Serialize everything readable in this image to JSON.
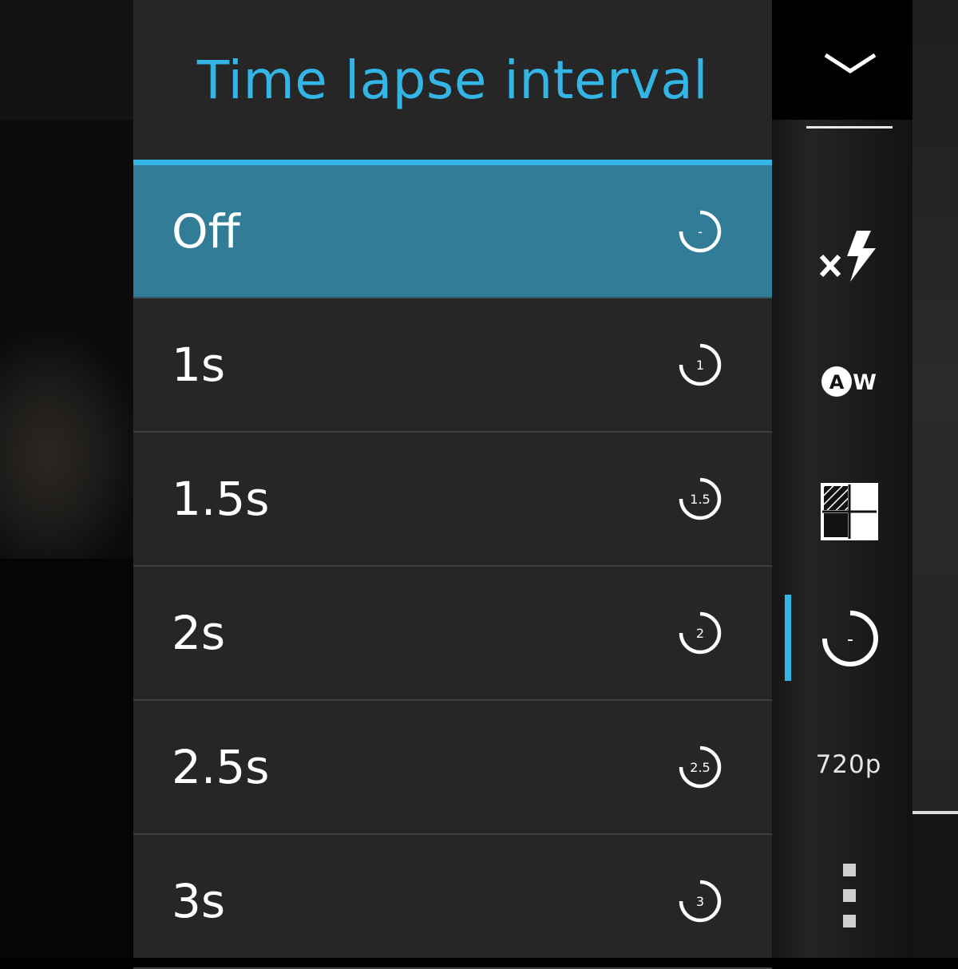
{
  "dialog": {
    "title": "Time lapse interval",
    "accent_color": "#33b5e5",
    "selected_color": "#317d98",
    "options": [
      {
        "label": "Off",
        "icon_text": "-",
        "selected": true
      },
      {
        "label": "1s",
        "icon_text": "1",
        "selected": false
      },
      {
        "label": "1.5s",
        "icon_text": "1.5",
        "selected": false
      },
      {
        "label": "2s",
        "icon_text": "2",
        "selected": false
      },
      {
        "label": "2.5s",
        "icon_text": "2.5",
        "selected": false
      },
      {
        "label": "3s",
        "icon_text": "3",
        "selected": false
      }
    ]
  },
  "sidebar": {
    "collapse_icon": "chevron-down-icon",
    "flash_icon": "flash-off-icon",
    "white_balance_icon": "white-balance-auto-icon",
    "white_balance_text": "W",
    "white_balance_badge": "A",
    "exposure_icon": "exposure-grid-icon",
    "timelapse_icon": "timelapse-off-icon",
    "timelapse_text": "-",
    "resolution_label": "720p",
    "more_icon": "more-options-icon"
  }
}
